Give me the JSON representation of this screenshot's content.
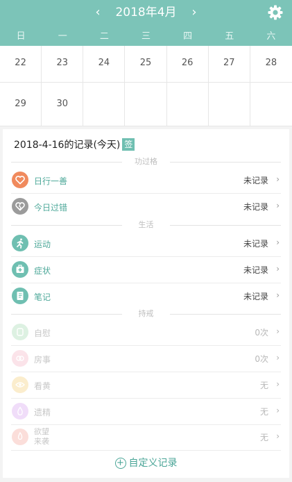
{
  "header": {
    "month_title": "2018年4月",
    "prev_glyph": "‹",
    "next_glyph": "›",
    "weekdays": [
      "日",
      "一",
      "二",
      "三",
      "四",
      "五",
      "六"
    ]
  },
  "calendar": {
    "week1": [
      "22",
      "23",
      "24",
      "25",
      "26",
      "27",
      "28"
    ],
    "week2": [
      "29",
      "30",
      "",
      "",
      "",
      "",
      ""
    ]
  },
  "records": {
    "title": "2018-4-16的记录(今天)",
    "sign_badge": "签",
    "sections": {
      "merit": "功过格",
      "life": "生活",
      "abstain": "持戒"
    },
    "merit": [
      {
        "label": "日行一善",
        "status": "未记录",
        "icon": "heart-icon"
      },
      {
        "label": "今日过错",
        "status": "未记录",
        "icon": "broken-heart-icon"
      }
    ],
    "life": [
      {
        "label": "运动",
        "status": "未记录",
        "icon": "running-icon"
      },
      {
        "label": "症状",
        "status": "未记录",
        "icon": "medical-kit-icon"
      },
      {
        "label": "笔记",
        "status": "未记录",
        "icon": "notebook-icon"
      }
    ],
    "abstain": [
      {
        "label": "自慰",
        "status": "0次",
        "icon": "self-icon"
      },
      {
        "label": "房事",
        "status": "0次",
        "icon": "couple-icon"
      },
      {
        "label": "看黄",
        "status": "无",
        "icon": "eye-icon"
      },
      {
        "label": "遗精",
        "status": "无",
        "icon": "drop-icon"
      },
      {
        "label_line1": "欲望",
        "label_line2": "来袭",
        "status": "无",
        "icon": "flame-icon"
      }
    ],
    "chevron": "›",
    "custom_record": "自定义记录",
    "plus_glyph": "+"
  },
  "colors": {
    "header": "#7cc4b8",
    "accent": "#4fa99a",
    "heart": "#f08a5d",
    "gray": "#9b9b9b",
    "teal_icon": "#6fbfb1"
  }
}
